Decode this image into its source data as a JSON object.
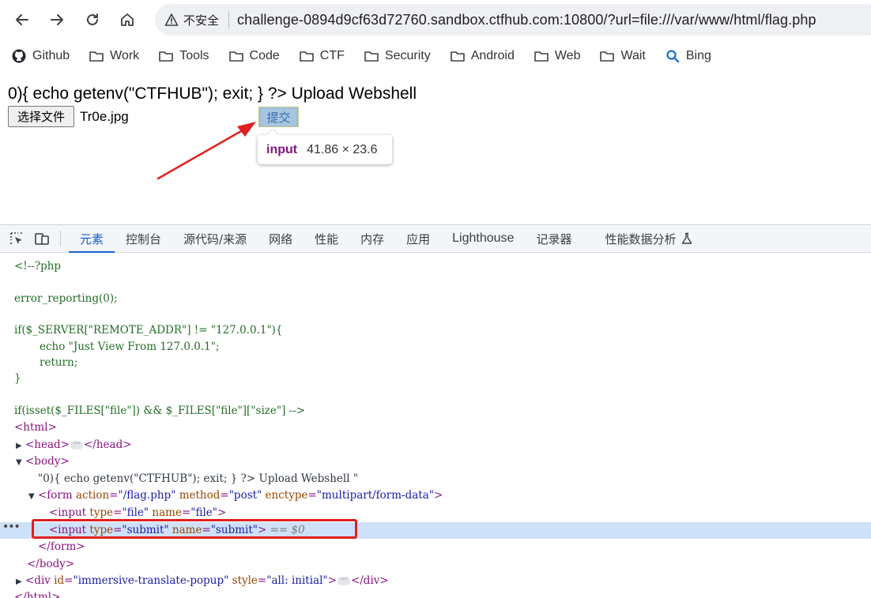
{
  "toolbar": {
    "security_label": "不安全",
    "url": "challenge-0894d9cf63d72760.sandbox.ctfhub.com:10800/?url=file:///var/www/html/flag.php"
  },
  "bookmarks": [
    {
      "label": "Github",
      "icon": "github-icon"
    },
    {
      "label": "Work",
      "icon": "folder-icon"
    },
    {
      "label": "Tools",
      "icon": "folder-icon"
    },
    {
      "label": "Code",
      "icon": "folder-icon"
    },
    {
      "label": "CTF",
      "icon": "folder-icon"
    },
    {
      "label": "Security",
      "icon": "folder-icon"
    },
    {
      "label": "Android",
      "icon": "folder-icon"
    },
    {
      "label": "Web",
      "icon": "folder-icon"
    },
    {
      "label": "Wait",
      "icon": "folder-icon"
    },
    {
      "label": "Bing",
      "icon": "search-icon"
    }
  ],
  "page": {
    "heading_text": "0){ echo getenv(\"CTFHUB\"); exit; } ?> Upload Webshell",
    "file_button_label": "选择文件",
    "file_name": "Tr0e.jpg",
    "submit_label": "提交",
    "tooltip_tag": "input",
    "tooltip_size": "41.86 × 23.6"
  },
  "devtools": {
    "tabs": [
      "元素",
      "控制台",
      "源代码/来源",
      "网络",
      "性能",
      "内存",
      "应用",
      "Lighthouse",
      "记录器",
      "性能数据分析"
    ],
    "active_tab": "元素",
    "code": {
      "l1": "<!--?php",
      "l2": "error_reporting(0);",
      "l3": "if($_SERVER[\"REMOTE_ADDR\"] != \"127.0.0.1\"){",
      "l4": "echo \"Just View From 127.0.0.1\";",
      "l5": "return;",
      "l6": "}",
      "l7": "if(isset($_FILES[\"file\"]) && $_FILES[\"file\"][\"size\"] -->",
      "body_text": "\"0){ echo getenv(\"CTFHUB\"); exit; } ?> Upload Webshell \"",
      "selected_marker": "== $0",
      "form_action": "\"/flag.php\"",
      "form_method": "\"post\"",
      "form_enctype": "\"multipart/form-data\"",
      "input1_type": "\"file\"",
      "input1_name": "\"file\"",
      "input2_type": "\"submit\"",
      "input2_name": "\"submit\"",
      "div_id": "\"immersive-translate-popup\"",
      "div_style": "\"all: initial\""
    }
  },
  "colors": {
    "accent": "#1a5fd0",
    "annotation_red": "#e02020",
    "tag": "#881280",
    "attr_name": "#994500",
    "attr_value": "#1a1aa6",
    "comment": "#236e25",
    "selected_row": "#cfe1f8"
  }
}
